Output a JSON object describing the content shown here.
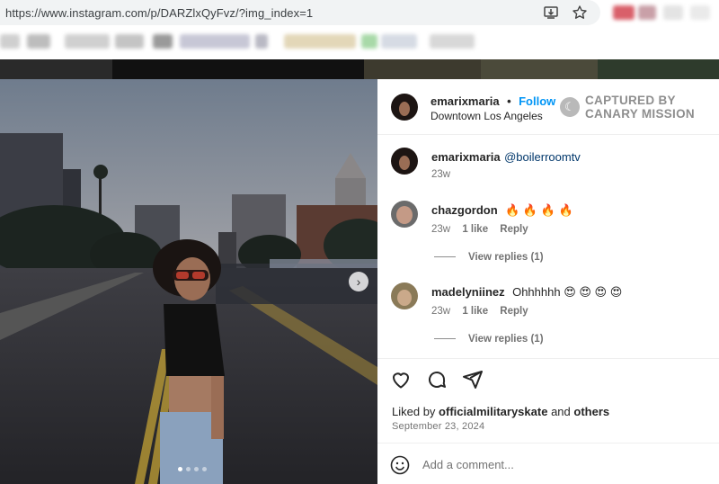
{
  "browser": {
    "url": "https://www.instagram.com/p/DARZlxQyFvz/?img_index=1",
    "icons": [
      "install-app-icon",
      "star-icon"
    ]
  },
  "post": {
    "author": "emarixmaria",
    "separator": "•",
    "follow_label": "Follow",
    "location": "Downtown Los Angeles",
    "watermark_line1": "CAPTURED BY",
    "watermark_line2": "CANARY MISSION",
    "caption": {
      "user": "emarixmaria",
      "mention": "@boilerroomtv",
      "time": "23w"
    },
    "comments": [
      {
        "user": "chazgordon",
        "text": "🔥 🔥 🔥 🔥",
        "time": "23w",
        "likes": "1 like",
        "reply_label": "Reply",
        "view_replies": "View replies (1)"
      },
      {
        "user": "madelyniinez",
        "text": "Ohhhhhh 😍 😍 😍 😍",
        "time": "23w",
        "likes": "1 like",
        "reply_label": "Reply",
        "view_replies": "View replies (1)"
      }
    ],
    "liked_by_prefix": "Liked by",
    "liked_by_user": "officialmilitaryskate",
    "liked_by_and": "and",
    "liked_by_others": "others",
    "date": "September 23, 2024",
    "add_comment_placeholder": "Add a comment..."
  },
  "carousel": {
    "next_icon": "chevron-right-icon",
    "dot_count": 4,
    "active_dot": 0
  },
  "colors": {
    "accent": "#0095f6",
    "mention": "#00376b",
    "muted": "#737373"
  }
}
